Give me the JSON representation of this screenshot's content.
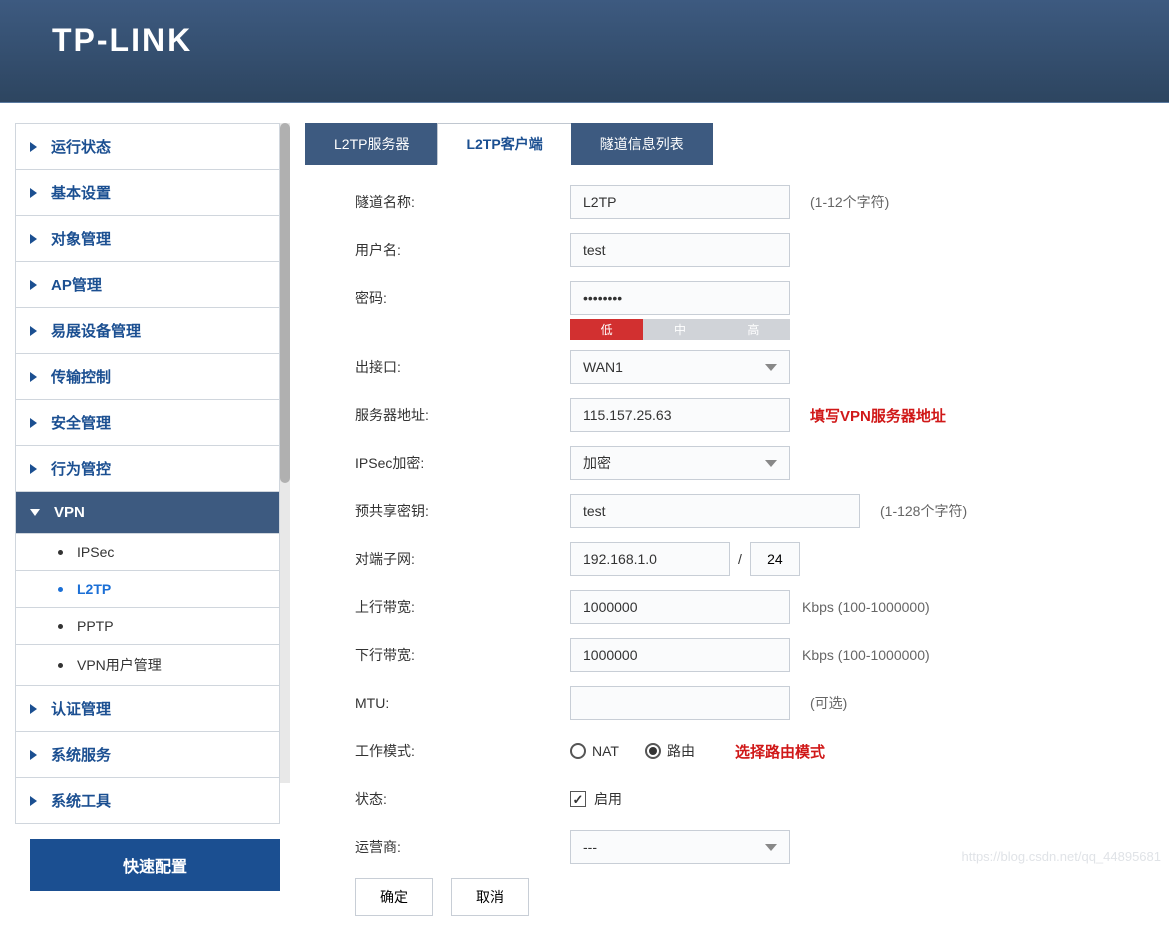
{
  "brand": "TP-LINK",
  "sidebar": {
    "items": [
      {
        "label": "运行状态"
      },
      {
        "label": "基本设置"
      },
      {
        "label": "对象管理"
      },
      {
        "label": "AP管理"
      },
      {
        "label": "易展设备管理"
      },
      {
        "label": "传输控制"
      },
      {
        "label": "安全管理"
      },
      {
        "label": "行为管控"
      },
      {
        "label": "VPN",
        "active": true,
        "children": [
          {
            "label": "IPSec"
          },
          {
            "label": "L2TP",
            "selected": true
          },
          {
            "label": "PPTP"
          },
          {
            "label": "VPN用户管理"
          }
        ]
      },
      {
        "label": "认证管理"
      },
      {
        "label": "系统服务"
      },
      {
        "label": "系统工具"
      }
    ],
    "quick_config": "快速配置"
  },
  "tabs": [
    {
      "label": "L2TP服务器"
    },
    {
      "label": "L2TP客户端",
      "active": true
    },
    {
      "label": "隧道信息列表"
    }
  ],
  "form": {
    "tunnel_name": {
      "label": "隧道名称:",
      "value": "L2TP",
      "hint": "(1-12个字符)"
    },
    "username": {
      "label": "用户名:",
      "value": "test"
    },
    "password": {
      "label": "密码:",
      "value": "••••••••"
    },
    "strength": {
      "low": "低",
      "mid": "中",
      "high": "高"
    },
    "interface": {
      "label": "出接口:",
      "value": "WAN1"
    },
    "server_addr": {
      "label": "服务器地址:",
      "value": "115.157.25.63",
      "annot": "填写VPN服务器地址"
    },
    "ipsec": {
      "label": "IPSec加密:",
      "value": "加密"
    },
    "psk": {
      "label": "预共享密钥:",
      "value": "test",
      "hint": "(1-128个字符)"
    },
    "peer_subnet": {
      "label": "对端子网:",
      "value": "192.168.1.0",
      "mask": "24",
      "sep": "/"
    },
    "up_bw": {
      "label": "上行带宽:",
      "value": "1000000",
      "hint": "Kbps (100-1000000)"
    },
    "down_bw": {
      "label": "下行带宽:",
      "value": "1000000",
      "hint": "Kbps (100-1000000)"
    },
    "mtu": {
      "label": "MTU:",
      "value": "",
      "hint": "(可选)"
    },
    "mode": {
      "label": "工作模式:",
      "nat": "NAT",
      "route": "路由",
      "selected": "route",
      "annot": "选择路由模式"
    },
    "status": {
      "label": "状态:",
      "enabled": "启用",
      "checked": true
    },
    "isp": {
      "label": "运营商:",
      "value": "---"
    },
    "ok": "确定",
    "cancel": "取消"
  },
  "watermark": "https://blog.csdn.net/qq_44895681"
}
